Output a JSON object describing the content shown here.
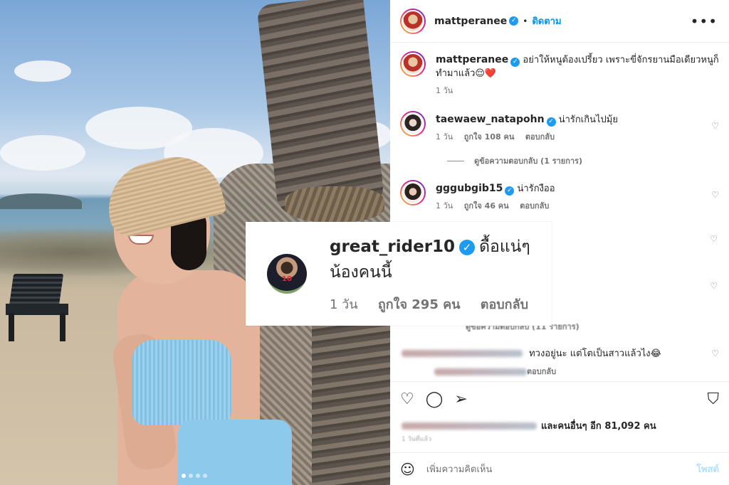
{
  "header": {
    "username": "mattperanee",
    "separator": "•",
    "follow_label": "ติดตาม",
    "more_label": "•••"
  },
  "caption": {
    "username": "mattperanee",
    "text": "อย่าให้หนูต้องเปรี้ยว เพราะขี่จักรยานมือเดียวหนูก็ทำมาแล้ว😌❤️",
    "time": "1 วัน"
  },
  "comments": [
    {
      "username": "taewaew_natapohn",
      "text": "น่ารักเกินไปมุ้ย",
      "time": "1 วัน",
      "likes": "ถูกใจ 108 คน",
      "reply": "ตอบกลับ"
    },
    {
      "username": "gggubgib15",
      "text": "น่ารักงืออ",
      "time": "1 วัน",
      "likes": "ถูกใจ 46 คน",
      "reply": "ตอบกลับ"
    }
  ],
  "view_replies": "ดูข้อความตอบกลับ (1 รายการ)",
  "partial_replies": "ดูข้อความตอบกลับ (11 รายการ)",
  "blurred_comment": {
    "text": "ทวงอยู่นะ แต่โตเป็นสาวแล้วไง😂",
    "reply": "ตอบกลับ"
  },
  "likes_summary": "และคนอื่นๆ อีก 81,092 คน",
  "posted_ago": "1 วันที่แล้ว",
  "add_comment": {
    "placeholder": "เพิ่มความคิดเห็น",
    "post_label": "โพสต์"
  },
  "zoom_comment": {
    "username": "great_rider10",
    "text": "ดื้อแน่ๆน้องคนนี้",
    "time": "1 วัน",
    "likes": "ถูกใจ 295 คน",
    "reply": "ตอบกลับ",
    "jersey_number": "10"
  },
  "icons": {
    "verified": "✓",
    "heart": "♡",
    "comment": "◯",
    "share": "➢",
    "bookmark": "⛉",
    "emoji": "☺"
  },
  "carousel": {
    "count": 4,
    "active_index": 0
  },
  "colors": {
    "link_blue": "#0095f6",
    "verified_blue": "#1d9bf0",
    "post_disabled": "#b2dffc"
  }
}
